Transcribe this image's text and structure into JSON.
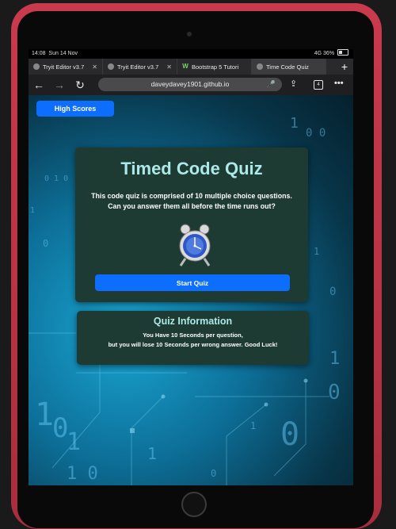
{
  "status": {
    "time": "14:08",
    "date": "Sun 14 Nov",
    "signal": "4G",
    "battery": "36%"
  },
  "tabs": [
    {
      "label": "Tryit Editor v3.7",
      "icon": "globe-icon"
    },
    {
      "label": "Tryit Editor v3.7",
      "icon": "globe-icon"
    },
    {
      "label": "Bootstrap 5 Tutori",
      "icon": "w3schools-icon"
    },
    {
      "label": "Time Code Quiz",
      "icon": "globe-icon",
      "active": true
    }
  ],
  "url": "daveydavey1901.github.io",
  "page": {
    "high_scores_label": "High Scores",
    "quiz_title": "Timed Code Quiz",
    "quiz_description_line1": "This code quiz is comprised of 10 multiple choice questions.",
    "quiz_description_line2": "Can you answer them all before the time runs out?",
    "start_label": "Start Quiz",
    "info_title": "Quiz Information",
    "info_line1": "You Have 10 Seconds per question,",
    "info_line2": "but you will lose 10 Seconds per wrong answer. Good Luck!"
  },
  "colors": {
    "accent": "#0d6efd",
    "card_bg": "#1d3a33",
    "title": "#aee9e9",
    "case": "#c93a4c"
  }
}
